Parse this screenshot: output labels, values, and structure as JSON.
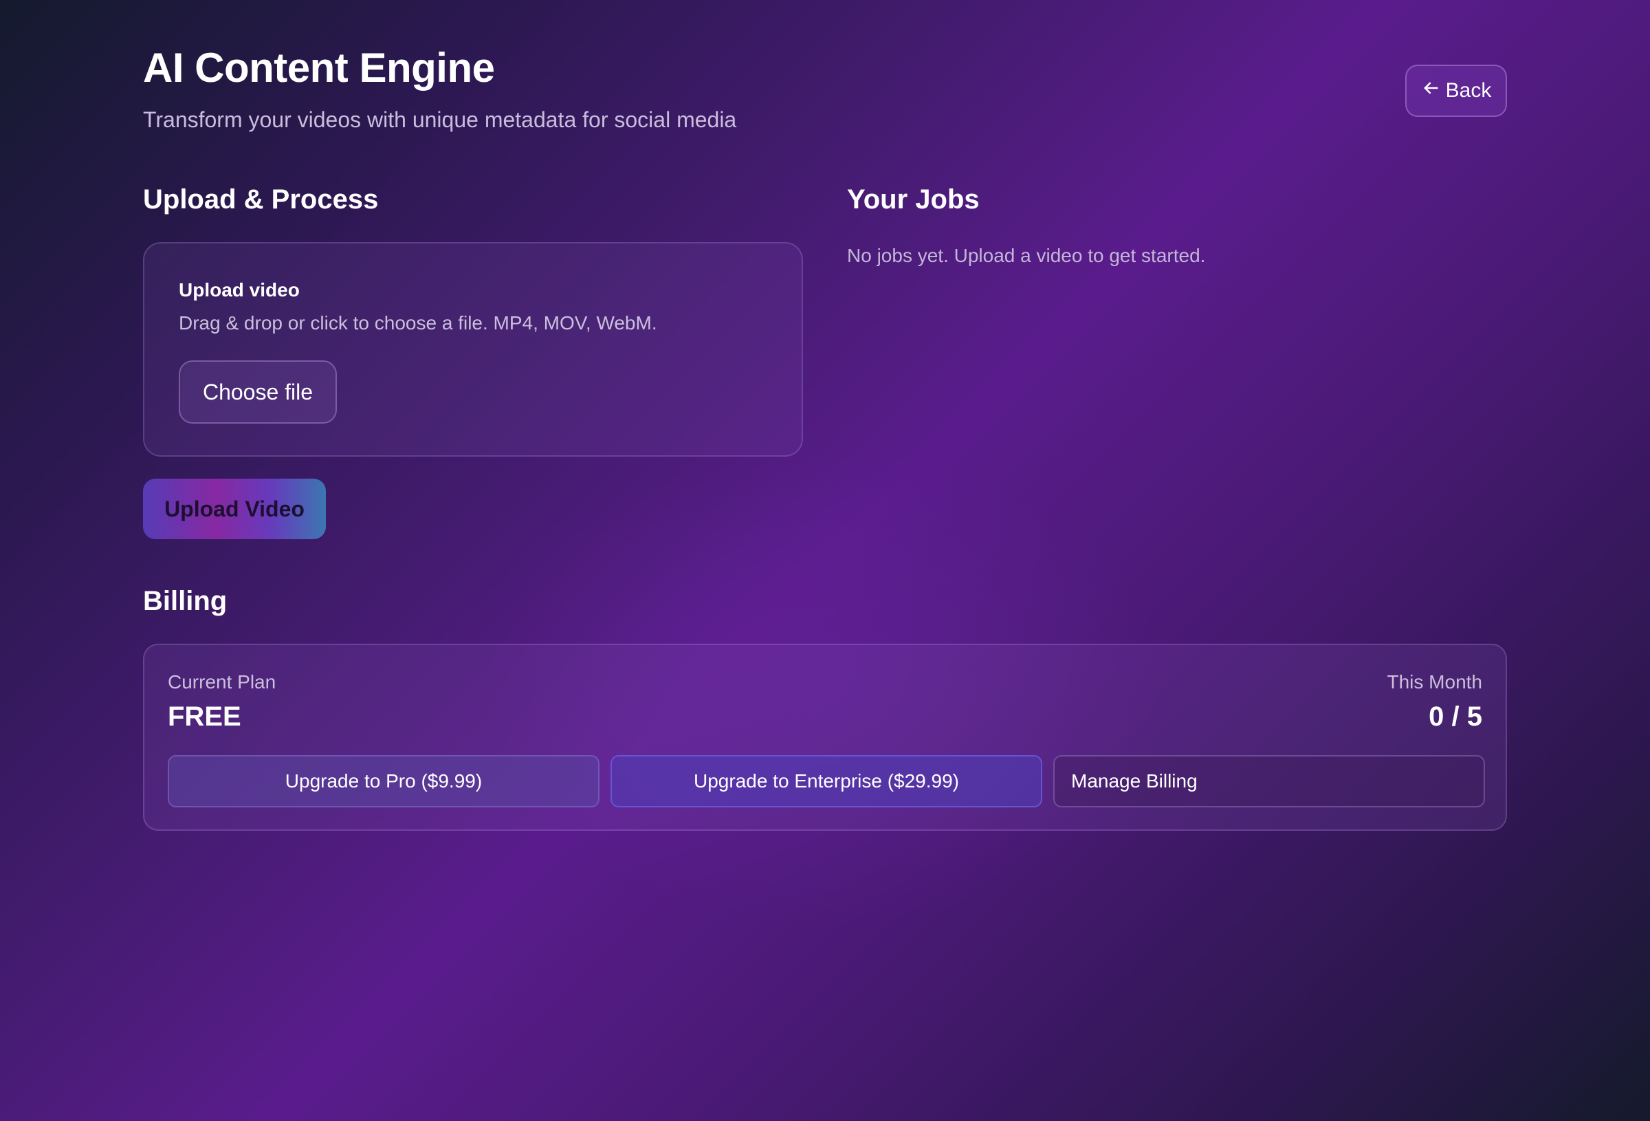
{
  "header": {
    "title": "AI Content Engine",
    "subtitle": "Transform your videos with unique metadata for social media",
    "back_label": "Back",
    "back_icon": "arrow-left-icon"
  },
  "upload": {
    "section_title": "Upload & Process",
    "card_label": "Upload video",
    "card_hint": "Drag & drop or click to choose a file. MP4, MOV, WebM.",
    "choose_file_label": "Choose file",
    "upload_button_label": "Upload Video"
  },
  "jobs": {
    "section_title": "Your Jobs",
    "empty_message": "No jobs yet. Upload a video to get started."
  },
  "billing": {
    "section_title": "Billing",
    "current_plan_label": "Current Plan",
    "current_plan_value": "FREE",
    "this_month_label": "This Month",
    "this_month_value": "0 / 5",
    "upgrade_pro_label": "Upgrade to Pro ($9.99)",
    "upgrade_enterprise_label": "Upgrade to Enterprise ($29.99)",
    "manage_billing_label": "Manage Billing"
  },
  "colors": {
    "background_mid": "#5a1c8c",
    "background_edge": "#141a2e",
    "upload_gradient_start": "#5a3fbf",
    "upload_gradient_mid": "#8e2aa8",
    "upload_gradient_end": "#3d7fb8"
  }
}
